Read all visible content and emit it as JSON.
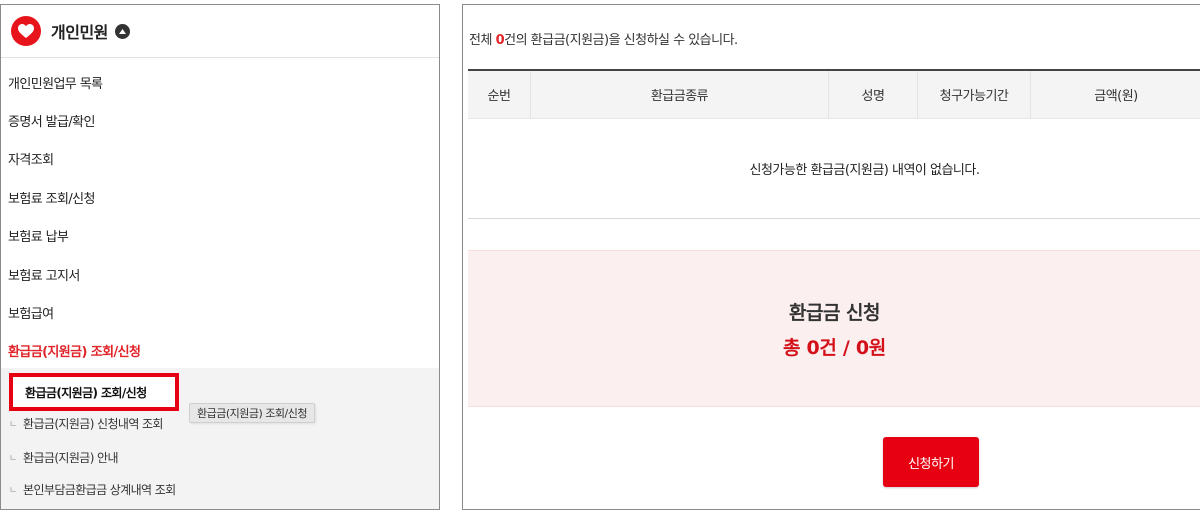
{
  "sidebar": {
    "title": "개인민원",
    "items": [
      {
        "label": "개인민원업무 목록"
      },
      {
        "label": "증명서 발급/확인"
      },
      {
        "label": "자격조회"
      },
      {
        "label": "보험료 조회/신청"
      },
      {
        "label": "보험료 납부"
      },
      {
        "label": "보험료 고지서"
      },
      {
        "label": "보험급여"
      },
      {
        "label": "환급금(지원금) 조회/신청",
        "active": true
      }
    ],
    "subitems": [
      {
        "label": "환급금(지원금) 조회/신청",
        "current": true
      },
      {
        "label": "환급금(지원금) 신청내역 조회"
      },
      {
        "label": "환급금(지원금) 안내"
      },
      {
        "label": "본인부담금환급금 상계내역 조회"
      }
    ],
    "tooltip": "환급금(지원금) 조회/신청",
    "sub_marker": "ㄴ"
  },
  "main": {
    "summary": {
      "prefix": "전체 ",
      "count": "0",
      "suffix": "건의 환급금(지원금)을 신청하실 수 있습니다."
    },
    "table": {
      "columns": [
        "순번",
        "환급금종류",
        "성명",
        "청구가능기간",
        "금액(원)"
      ],
      "empty_message": "신청가능한 환급금(지원금) 내역이 없습니다."
    },
    "apply": {
      "title": "환급금 신청",
      "total": "총 0건 / 0원",
      "button_label": "신청하기"
    }
  },
  "colors": {
    "accent": "#e60012",
    "active_text": "#e0242a",
    "apply_bg": "#fcefef"
  },
  "icons": {
    "logo": "heart-logo-icon",
    "collapse": "chevron-up-icon"
  }
}
